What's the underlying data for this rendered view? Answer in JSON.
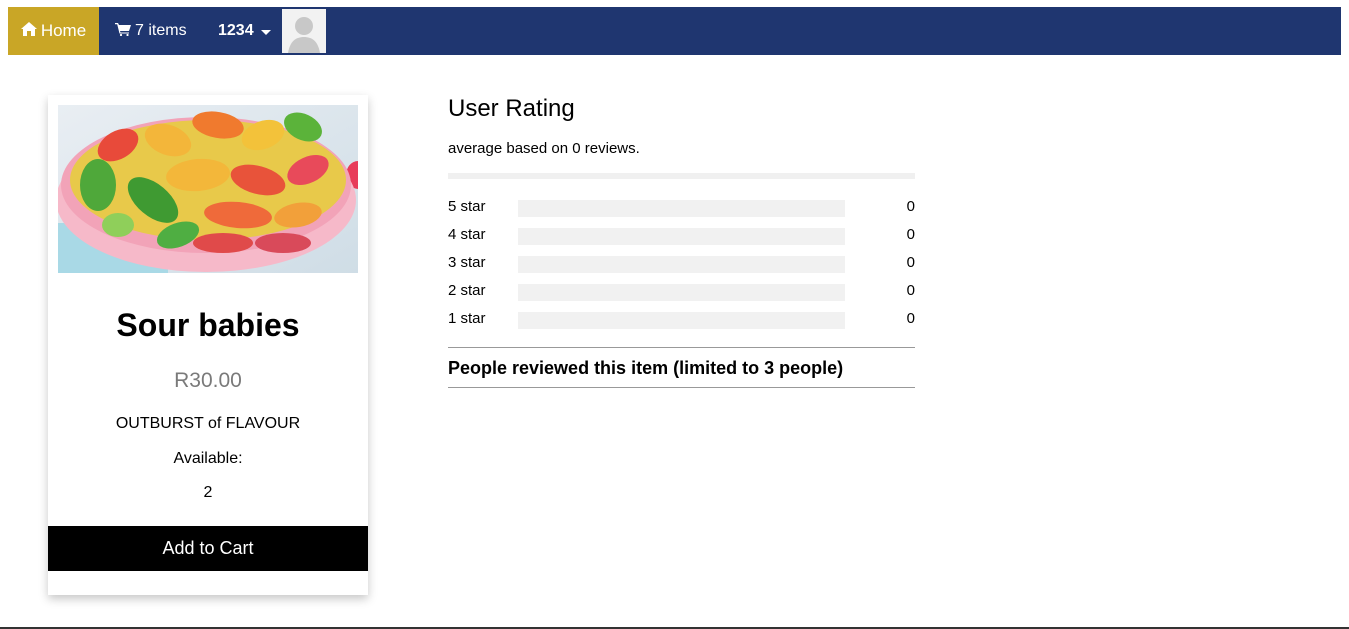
{
  "nav": {
    "home_label": "Home",
    "cart_label": "7 items",
    "user_label": "1234",
    "colors": {
      "bar": "#1f3670",
      "home": "#c9a626"
    }
  },
  "product": {
    "name": "Sour babies",
    "price": "R30.00",
    "description": "OUTBURST of FLAVOUR",
    "available_label": "Available:",
    "available_value": "2",
    "add_button": "Add to Cart"
  },
  "rating": {
    "title": "User Rating",
    "subtitle": "average based on 0 reviews.",
    "stars": [
      {
        "label": "5 star",
        "count": "0",
        "fraction": 0
      },
      {
        "label": "4 star",
        "count": "0",
        "fraction": 0
      },
      {
        "label": "3 star",
        "count": "0",
        "fraction": 0
      },
      {
        "label": "2 star",
        "count": "0",
        "fraction": 0
      },
      {
        "label": "1 star",
        "count": "0",
        "fraction": 0
      }
    ],
    "reviewed_heading": "People reviewed this item (limited to 3 people)"
  }
}
